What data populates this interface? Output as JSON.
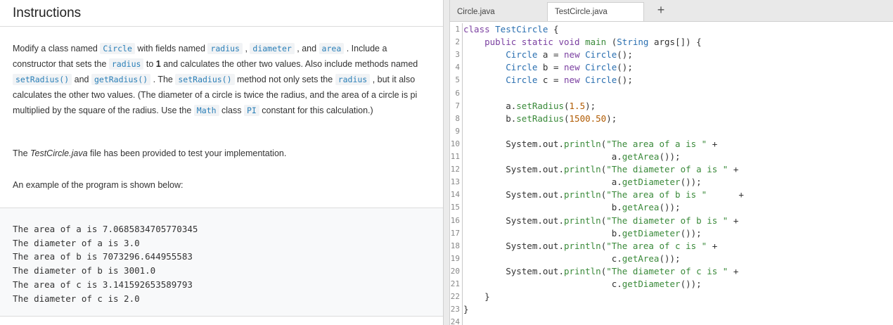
{
  "instructions": {
    "title": "Instructions",
    "para1": {
      "t1": "Modify a class named ",
      "c1": "Circle",
      "t2": " with fields named ",
      "c2": "radius",
      "t3": " , ",
      "c3": "diameter",
      "t4": " , and ",
      "c4": "area",
      "t5": " . Include a constructor that sets the ",
      "c5": "radius",
      "t6": " to ",
      "b1": "1",
      "t7": " and calculates the other two values. Also include methods named ",
      "c6": "setRadius()",
      "t8": " and ",
      "c7": "getRadius()",
      "t9": " . The ",
      "c8": "setRadius()",
      "t10": " method not only sets the ",
      "c9": "radius",
      "t11": " , but it also calculates the other two values. (The diameter of a circle is twice the radius, and the area of a circle is pi multiplied by the square of the radius. Use the ",
      "c10": "Math",
      "t12": " class ",
      "c11": "PI",
      "t13": " constant for this calculation.)"
    },
    "para2": {
      "t1": "The ",
      "em": "TestCircle.java",
      "t2": " file has been provided to test your implementation."
    },
    "para3": "An example of the program is shown below:",
    "example_output": [
      "The area of a is 7.0685834705770345",
      "The diameter of a is 3.0",
      "The area of b is 7073296.644955583",
      "The diameter of b is 3001.0",
      "The area of c is 3.141592653589793",
      "The diameter of c is 2.0"
    ]
  },
  "editor": {
    "tabs": [
      {
        "label": "Circle.java"
      },
      {
        "label": "TestCircle.java"
      }
    ],
    "add_tab": "+",
    "line_numbers": [
      "1",
      "2",
      "3",
      "4",
      "5",
      "6",
      "7",
      "8",
      "9",
      "10",
      "11",
      "12",
      "13",
      "14",
      "15",
      "16",
      "17",
      "18",
      "19",
      "20",
      "21",
      "22",
      "23",
      "24"
    ]
  }
}
